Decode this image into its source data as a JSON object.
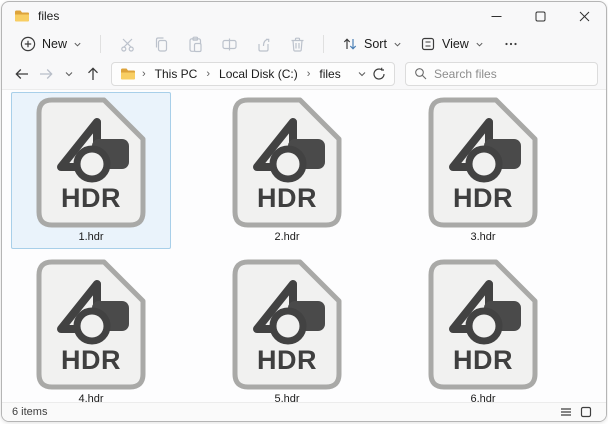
{
  "window": {
    "title": "files"
  },
  "toolbar": {
    "new_label": "New",
    "sort_label": "Sort",
    "view_label": "View"
  },
  "addressbar": {
    "breadcrumbs": [
      "This PC",
      "Local Disk (C:)",
      "files"
    ],
    "separator": "›"
  },
  "search": {
    "placeholder": "Search files"
  },
  "files": {
    "icon_label": "HDR",
    "items": [
      {
        "name": "1.hdr",
        "selected": true
      },
      {
        "name": "2.hdr",
        "selected": false
      },
      {
        "name": "3.hdr",
        "selected": false
      },
      {
        "name": "4.hdr",
        "selected": false
      },
      {
        "name": "5.hdr",
        "selected": false
      },
      {
        "name": "6.hdr",
        "selected": false
      }
    ]
  },
  "statusbar": {
    "items_count": "6 items"
  },
  "colors": {
    "selection_bg": "#eaf3fb",
    "selection_border": "#a8cfe9",
    "folder_yellow": "#f8ce63",
    "file_icon_fill": "#f1f1f0",
    "file_icon_border": "#a9a9a7",
    "file_icon_glyph": "#424242",
    "disabled_icon": "#bcc2cc"
  }
}
